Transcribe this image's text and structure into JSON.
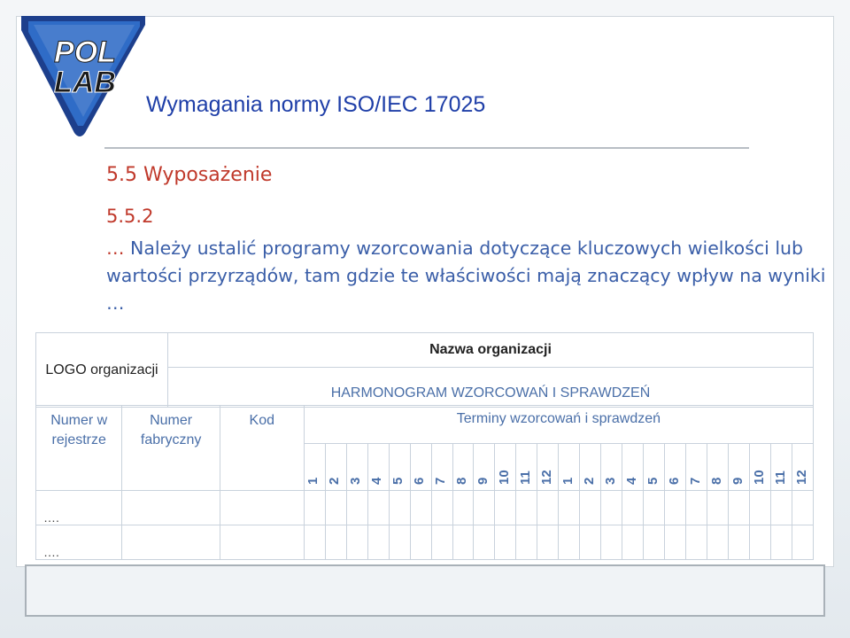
{
  "logo": {
    "line1": "POL",
    "line2": "LAB"
  },
  "header": {
    "title": "Wymagania normy ISO/IEC 17025",
    "subtitle": "5.5 Wyposażenie",
    "section": "5.5.2"
  },
  "content": {
    "lead": "… ",
    "text": "Należy ustalić programy wzorcowania dotyczące kluczowych wielkości lub wartości przyrządów, tam gdzie te właściwości mają znaczący wpływ na wyniki …"
  },
  "form": {
    "logo_cell": "LOGO organizacji",
    "org_name": "Nazwa organizacji",
    "doc_title": "HARMONOGRAM WZORCOWAŃ I SPRAWDZEŃ",
    "columns": {
      "reg_number": "Numer w rejestrze",
      "serial_number": "Numer fabryczny",
      "code": "Kod",
      "terms": "Terminy wzorcowań i sprawdzeń"
    },
    "months": [
      "1",
      "2",
      "3",
      "4",
      "5",
      "6",
      "7",
      "8",
      "9",
      "10",
      "11",
      "12",
      "1",
      "2",
      "3",
      "4",
      "5",
      "6",
      "7",
      "8",
      "9",
      "10",
      "11",
      "12"
    ],
    "rows": [
      {
        "reg": "…."
      },
      {
        "reg": "…."
      }
    ]
  },
  "colors": {
    "title": "#1f3fa8",
    "accent_red": "#c0392b",
    "text_blue": "#3a5ea8"
  }
}
